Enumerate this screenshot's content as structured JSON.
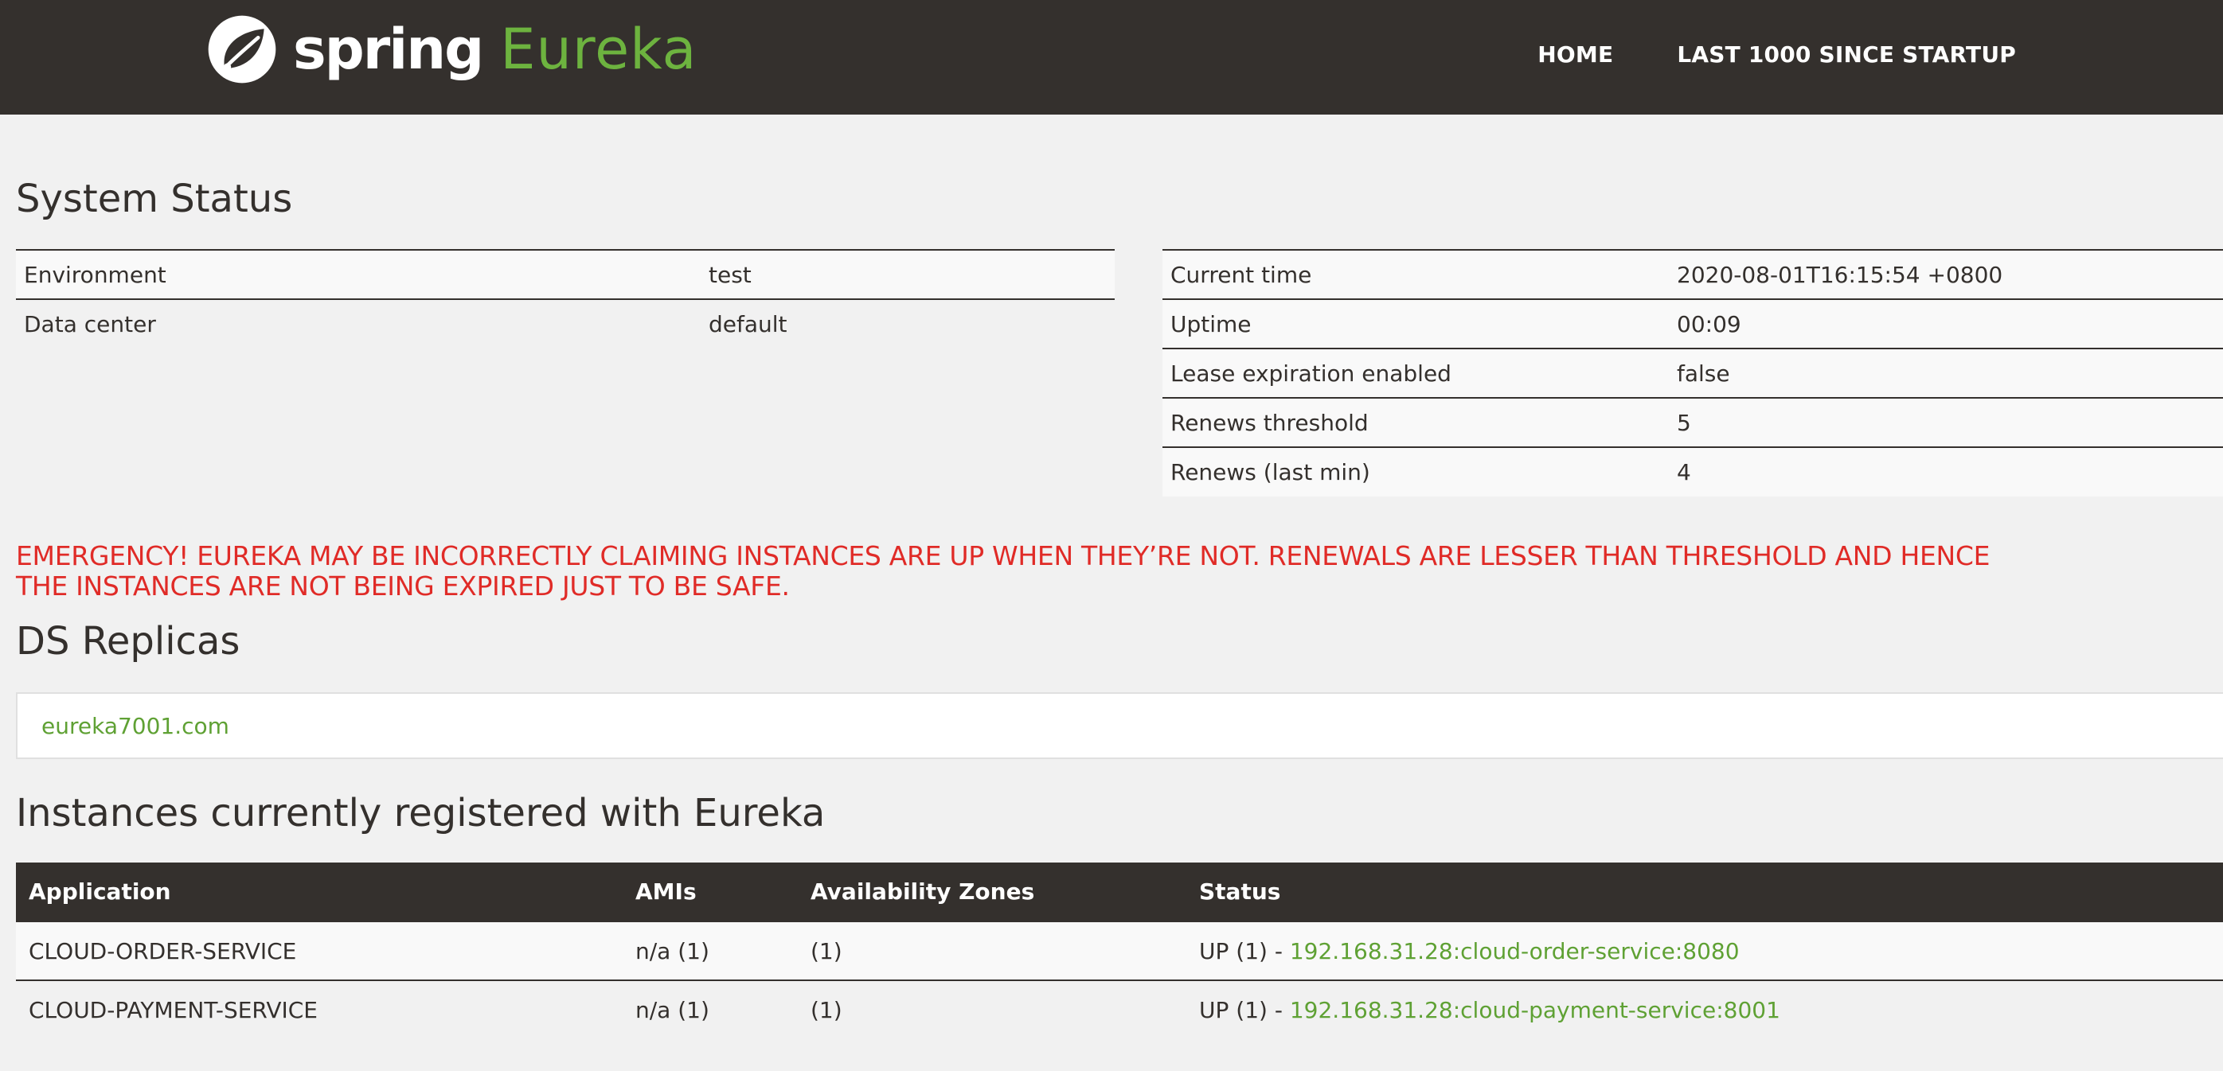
{
  "header": {
    "brand_spring": "spring",
    "brand_eureka": "Eureka",
    "logo_icon": "spring-leaf-icon",
    "nav": [
      {
        "label": "HOME"
      },
      {
        "label": "LAST 1000 SINCE STARTUP"
      }
    ]
  },
  "system_status": {
    "title": "System Status",
    "left": [
      {
        "key": "Environment",
        "value": "test"
      },
      {
        "key": "Data center",
        "value": "default"
      }
    ],
    "right": [
      {
        "key": "Current time",
        "value": "2020-08-01T16:15:54 +0800"
      },
      {
        "key": "Uptime",
        "value": "00:09"
      },
      {
        "key": "Lease expiration enabled",
        "value": "false"
      },
      {
        "key": "Renews threshold",
        "value": "5"
      },
      {
        "key": "Renews (last min)",
        "value": "4"
      }
    ]
  },
  "emergency": {
    "line1": "EMERGENCY! EUREKA MAY BE INCORRECTLY CLAIMING INSTANCES ARE UP WHEN THEY’RE NOT. RENEWALS ARE LESSER THAN THRESHOLD AND HENCE",
    "line2": "THE INSTANCES ARE NOT BEING EXPIRED JUST TO BE SAFE.",
    "color": "#e02b27"
  },
  "ds_replicas": {
    "title": "DS Replicas",
    "items": [
      {
        "label": "eureka7001.com"
      }
    ]
  },
  "instances": {
    "title": "Instances currently registered with Eureka",
    "headers": [
      "Application",
      "AMIs",
      "Availability Zones",
      "Status"
    ],
    "rows": [
      {
        "application": "CLOUD-ORDER-SERVICE",
        "amis": "n/a (1)",
        "zones": "(1)",
        "status_prefix": "UP (1) - ",
        "status_link": "192.168.31.28:cloud-order-service:8080"
      },
      {
        "application": "CLOUD-PAYMENT-SERVICE",
        "amis": "n/a (1)",
        "zones": "(1)",
        "status_prefix": "UP (1) - ",
        "status_link": "192.168.31.28:cloud-payment-service:8001"
      }
    ]
  },
  "colors": {
    "header_bg": "#34302d",
    "accent_green": "#6db33f",
    "link_green": "#5fa134",
    "page_bg": "#f1f1f1"
  }
}
